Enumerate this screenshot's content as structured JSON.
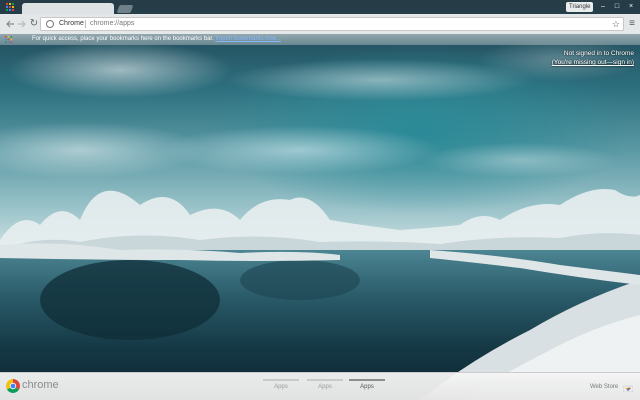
{
  "browser": {
    "tab_title": "",
    "profile_name": "Triangle",
    "window_controls": {
      "minimize": "–",
      "maximize": "□",
      "close": "×"
    }
  },
  "toolbar": {
    "back_icon": "back-arrow-icon",
    "forward_icon": "forward-arrow-icon",
    "reload_glyph": "↻",
    "omnibox_chip": "Chrome",
    "omnibox_url": "chrome://apps",
    "star_glyph": "☆",
    "menu_glyph": "≡"
  },
  "bookmarks_bar": {
    "text_prefix": "For quick access, place your bookmarks here on the bookmarks bar.",
    "link_text": "Import bookmarks now..."
  },
  "signin_notice": {
    "line1": "Not signed in to Chrome",
    "line2": "(You're missing out—sign in)"
  },
  "bottom_bar": {
    "brand": "chrome",
    "pages": [
      {
        "label": "Apps",
        "active": false
      },
      {
        "label": "Apps",
        "active": false
      },
      {
        "label": "Apps",
        "active": true
      }
    ],
    "webstore_label": "Web Store"
  },
  "colors": {
    "chrome_red": "#db4437",
    "chrome_yellow": "#f4c20d",
    "chrome_green": "#0f9d58",
    "chrome_blue": "#4285f4"
  }
}
